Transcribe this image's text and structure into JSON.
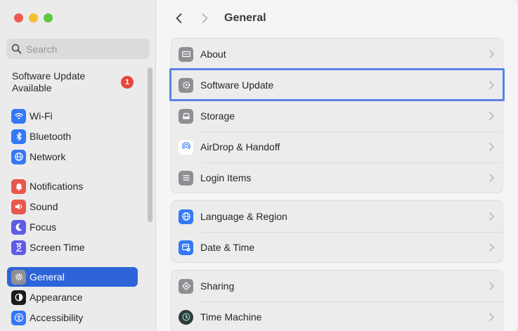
{
  "window": {
    "title": "General"
  },
  "sidebar": {
    "search": {
      "placeholder": "Search"
    },
    "update": {
      "label": "Software Update Available",
      "badge": "1"
    },
    "items": [
      {
        "label": "Wi-Fi",
        "icon": "wifi-icon",
        "color": "#3478f6"
      },
      {
        "label": "Bluetooth",
        "icon": "bluetooth-icon",
        "color": "#3478f6"
      },
      {
        "label": "Network",
        "icon": "globe-icon",
        "color": "#3478f6"
      },
      {
        "label": "Notifications",
        "icon": "bell-icon",
        "color": "#e8574d"
      },
      {
        "label": "Sound",
        "icon": "speaker-icon",
        "color": "#e8574d"
      },
      {
        "label": "Focus",
        "icon": "moon-icon",
        "color": "#5e5ce6"
      },
      {
        "label": "Screen Time",
        "icon": "hourglass-icon",
        "color": "#5e5ce6"
      },
      {
        "label": "General",
        "icon": "gear-icon",
        "color": "#8e8e93",
        "selected": true
      },
      {
        "label": "Appearance",
        "icon": "appearance-icon",
        "color": "#1c1c1e"
      },
      {
        "label": "Accessibility",
        "icon": "accessibility-icon",
        "color": "#3478f6"
      }
    ]
  },
  "main": {
    "groups": [
      {
        "rows": [
          {
            "label": "About",
            "icon": "laptop-icon",
            "color": "#8e8e93"
          },
          {
            "label": "Software Update",
            "icon": "gear-update-icon",
            "color": "#8e8e93",
            "highlighted": true
          },
          {
            "label": "Storage",
            "icon": "drive-icon",
            "color": "#8e8e93"
          },
          {
            "label": "AirDrop & Handoff",
            "icon": "airdrop-icon",
            "color": "#ffffff"
          },
          {
            "label": "Login Items",
            "icon": "list-icon",
            "color": "#8e8e93"
          }
        ]
      },
      {
        "rows": [
          {
            "label": "Language & Region",
            "icon": "globe-icon",
            "color": "#3478f6"
          },
          {
            "label": "Date & Time",
            "icon": "calendar-clock-icon",
            "color": "#3478f6"
          }
        ]
      },
      {
        "rows": [
          {
            "label": "Sharing",
            "icon": "sharing-icon",
            "color": "#8e8e93"
          },
          {
            "label": "Time Machine",
            "icon": "time-machine-icon",
            "color": "#2f3b3a"
          }
        ]
      }
    ]
  }
}
